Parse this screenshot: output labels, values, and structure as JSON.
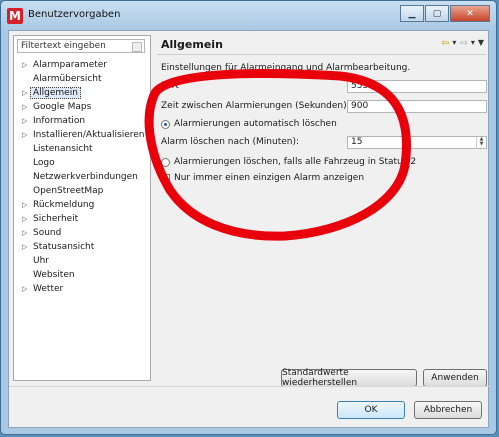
{
  "window": {
    "title": "Benutzervorgaben"
  },
  "sidebar": {
    "filter_placeholder": "Filtertext eingeben",
    "items": [
      {
        "label": "Alarmparameter",
        "expandable": true
      },
      {
        "label": "Alarmübersicht",
        "expandable": false
      },
      {
        "label": "Allgemein",
        "expandable": true,
        "selected": true
      },
      {
        "label": "Google Maps",
        "expandable": true
      },
      {
        "label": "Information",
        "expandable": true
      },
      {
        "label": "Installieren/Aktualisieren",
        "expandable": true
      },
      {
        "label": "Listenansicht",
        "expandable": false
      },
      {
        "label": "Logo",
        "expandable": false
      },
      {
        "label": "Netzwerkverbindungen",
        "expandable": false
      },
      {
        "label": "OpenStreetMap",
        "expandable": false
      },
      {
        "label": "Rückmeldung",
        "expandable": true
      },
      {
        "label": "Sicherheit",
        "expandable": true
      },
      {
        "label": "Sound",
        "expandable": true
      },
      {
        "label": "Statusansicht",
        "expandable": true
      },
      {
        "label": "Uhr",
        "expandable": false
      },
      {
        "label": "Websiten",
        "expandable": false
      },
      {
        "label": "Wetter",
        "expandable": true
      }
    ]
  },
  "page": {
    "title": "Allgemein",
    "description": "Einstellungen für Alarmeingang und Alarmbearbeitung.",
    "port_label": "Port",
    "port_value": "5556",
    "interval_label": "Zeit zwischen Alarmierungen (Sekunden):",
    "interval_value": "900",
    "radio_auto_delete": "Alarmierungen automatisch löschen",
    "delete_after_label": "Alarm löschen nach (Minuten):",
    "delete_after_value": "15",
    "radio_status_delete": "Alarmierungen löschen, falls alle Fahrzeug in Status 2",
    "checkbox_single_alarm": "Nur immer einen einzigen Alarm anzeigen"
  },
  "buttons": {
    "restore_defaults": "Standardwerte wiederherstellen",
    "apply": "Anwenden",
    "ok": "OK",
    "cancel": "Abbrechen"
  },
  "colors": {
    "annotation": "#e8000b",
    "accent": "#3c7fb1"
  }
}
